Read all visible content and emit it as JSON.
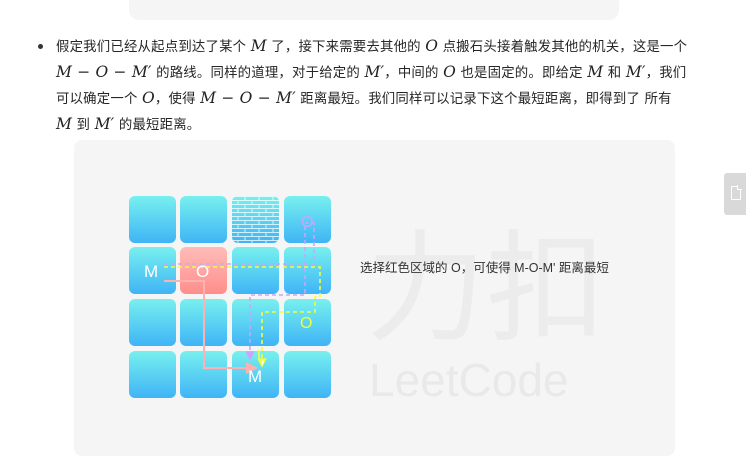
{
  "paragraph": {
    "t1": "假定我们已经从起点到达了某个 ",
    "m1": "M",
    "t2": " 了，接下来需要去其他的 ",
    "m2": "O",
    "t3": " 点搬石头接着触发其他的机关，这是一个 ",
    "m3": "M − O − M′",
    "t4": " 的路线。同样的道理，对于给定的 ",
    "m4": "M′",
    "t5": "，中间的 ",
    "m5": "O",
    "t6": " 也是固定的。即给定 ",
    "m6": "M",
    "t7": " 和 ",
    "m7": "M′",
    "t8": "，我们可以确定一个 ",
    "m8": "O",
    "t9": "，使得 ",
    "m9": "M − O − M′",
    "t10": " 距离最短。我们同样可以记录下这个最短距离，即得到了 所有 ",
    "m10": "M",
    "t11": " 到 ",
    "m11": "M′",
    "t12": " 的最短距离。"
  },
  "figure": {
    "labels": {
      "m_start": "M",
      "o_red": "O",
      "o_purple": "O",
      "o_yellow": "O",
      "m_end": "M"
    },
    "caption": "选择红色区域的 O，可使得 M-O-M' 距离最短",
    "watermark": {
      "hanzi": "力扣",
      "latin": "LeetCode"
    },
    "colors": {
      "tile_top": "#78f0ee",
      "tile_bottom": "#3fb4f6",
      "tile_red_top": "#ffb9b5",
      "tile_red_bottom": "#ff8f8c",
      "path_yellow": "#f0ff3a",
      "path_purple": "#c8a6ff",
      "path_pink": "#ffb1b1"
    },
    "icons": [
      "wall-brick-icon",
      "arrow-down-icon"
    ]
  },
  "side_tab": {
    "icon": "document-icon"
  }
}
